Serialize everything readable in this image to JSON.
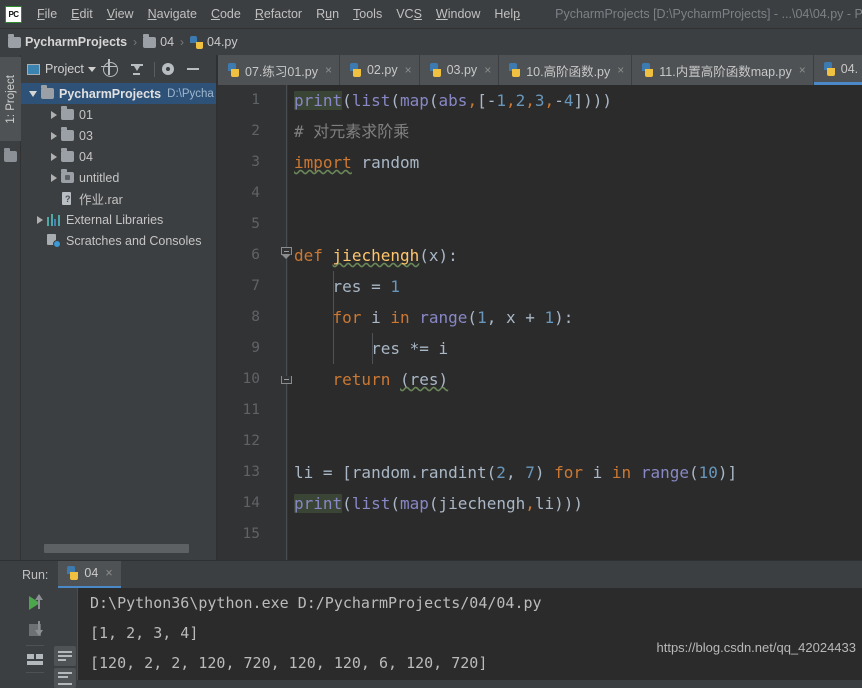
{
  "window": {
    "app_icon_label": "PC",
    "title": "PycharmProjects [D:\\PycharmProjects] - ...\\04\\04.py - P"
  },
  "menubar": {
    "items": [
      {
        "label": "File",
        "mnemonic": "F"
      },
      {
        "label": "Edit",
        "mnemonic": "E"
      },
      {
        "label": "View",
        "mnemonic": "V"
      },
      {
        "label": "Navigate",
        "mnemonic": "N"
      },
      {
        "label": "Code",
        "mnemonic": "C"
      },
      {
        "label": "Refactor",
        "mnemonic": "R"
      },
      {
        "label": "Run",
        "mnemonic": "u"
      },
      {
        "label": "Tools",
        "mnemonic": "T"
      },
      {
        "label": "VCS",
        "mnemonic": "S"
      },
      {
        "label": "Window",
        "mnemonic": "W"
      },
      {
        "label": "Help",
        "mnemonic": "H"
      }
    ]
  },
  "breadcrumb": {
    "separator": "›",
    "items": [
      {
        "label": "PycharmProjects",
        "icon": "folder-icon"
      },
      {
        "label": "04",
        "icon": "folder-icon"
      },
      {
        "label": "04.py",
        "icon": "python-file-icon"
      }
    ]
  },
  "left_strip": {
    "project_tab_label": "1: Project"
  },
  "project_panel": {
    "dropdown_label": "Project",
    "toolbar_icons": [
      "select-target-icon",
      "collapse-all-icon",
      "settings-gear-icon",
      "hide-panel-icon"
    ],
    "tree": [
      {
        "label": "PycharmProjects",
        "hint": "D:\\Pycha",
        "icon": "folder-icon",
        "twisty": "open",
        "depth": 0,
        "selected": true,
        "bold": true
      },
      {
        "label": "01",
        "hint": "",
        "icon": "folder-icon",
        "twisty": "closed",
        "depth": 1,
        "selected": false,
        "bold": false
      },
      {
        "label": "03",
        "hint": "",
        "icon": "folder-icon",
        "twisty": "closed",
        "depth": 1,
        "selected": false,
        "bold": false
      },
      {
        "label": "04",
        "hint": "",
        "icon": "folder-icon",
        "twisty": "closed",
        "depth": 1,
        "selected": false,
        "bold": false
      },
      {
        "label": "untitled",
        "hint": "",
        "icon": "module-folder-icon",
        "twisty": "closed",
        "depth": 1,
        "selected": false,
        "bold": false
      },
      {
        "label": "作业.rar",
        "hint": "",
        "icon": "archive-file-icon",
        "twisty": "none",
        "depth": 1,
        "selected": false,
        "bold": false
      },
      {
        "label": "External Libraries",
        "hint": "",
        "icon": "libraries-icon",
        "twisty": "closed",
        "depth": 0,
        "selected": false,
        "bold": false
      },
      {
        "label": "Scratches and Consoles",
        "hint": "",
        "icon": "scratches-icon",
        "twisty": "none",
        "depth": 0,
        "selected": false,
        "bold": false
      }
    ]
  },
  "editor_tabs": [
    {
      "label": "07.练习01.py",
      "active": false,
      "close": "×"
    },
    {
      "label": "02.py",
      "active": false,
      "close": "×"
    },
    {
      "label": "03.py",
      "active": false,
      "close": "×"
    },
    {
      "label": "10.高阶函数.py",
      "active": false,
      "close": "×"
    },
    {
      "label": "11.内置高阶函数map.py",
      "active": false,
      "close": "×"
    },
    {
      "label": "04.",
      "active": true,
      "close": ""
    }
  ],
  "editor": {
    "line_numbers": [
      "1",
      "2",
      "3",
      "4",
      "5",
      "6",
      "7",
      "8",
      "9",
      "10",
      "11",
      "12",
      "13",
      "14",
      "15"
    ],
    "lines": [
      "print(list(map(abs,[-1,2,3,-4])))",
      "# 对元素求阶乘",
      "import random",
      "",
      "",
      "def jiechengh(x):",
      "    res = 1",
      "    for i in range(1, x + 1):",
      "        res *= i",
      "    return (res)",
      "",
      "",
      "li = [random.randint(2, 7) for i in range(10)]",
      "print(list(map(jiechengh,li)))",
      ""
    ]
  },
  "run_panel": {
    "run_label": "Run:",
    "tab_label": "04",
    "tab_close": "×",
    "toolbar_icons": [
      "rerun-play-icon",
      "stop-icon",
      "print-icon",
      "scroll-up-icon",
      "scroll-down-icon",
      "soft-wrap-icon",
      "scroll-to-end-icon"
    ],
    "console_lines": [
      "D:\\Python36\\python.exe D:/PycharmProjects/04/04.py",
      "[1, 2, 3, 4]",
      "[120, 2, 2, 120, 720, 120, 120, 6, 120, 720]"
    ],
    "watermark": "https://blog.csdn.net/qq_42024433"
  },
  "colors": {
    "background": "#3c3f41",
    "editor_bg": "#2b2b2b",
    "gutter_bg": "#313335",
    "accent_tab_underline": "#4a88c7",
    "tree_selection": "#2d5177",
    "keyword": "#cc7832",
    "function": "#ffc66d",
    "number": "#6897bb",
    "builtin": "#8888c6",
    "comment": "#808080",
    "default_text": "#a9b7c6",
    "run_play_green": "#4ca64c"
  }
}
